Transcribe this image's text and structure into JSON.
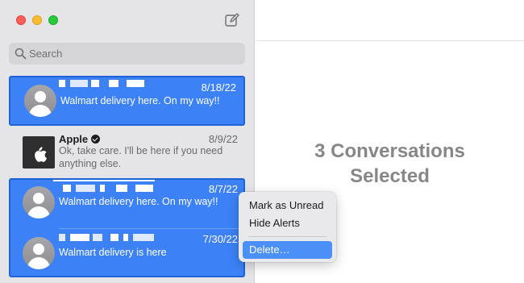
{
  "sidebar": {
    "search_placeholder": "Search",
    "conversations": [
      {
        "name": "",
        "date": "8/18/22",
        "preview": "Walmart delivery here. On my way!!",
        "selected": true
      },
      {
        "name": "Apple",
        "verified": true,
        "date": "8/9/22",
        "preview": "Ok, take care. I'll be here if you need anything else.",
        "selected": false
      },
      {
        "name": "",
        "date": "8/7/22",
        "preview": "Walmart delivery here. On my way!!",
        "selected": true
      },
      {
        "name": "",
        "date": "7/30/22",
        "preview": "Walmart delivery is here",
        "selected": true
      }
    ]
  },
  "main": {
    "status_line1": "3 Conversations",
    "status_line2": "Selected"
  },
  "context_menu": {
    "items": [
      "Mark as Unread",
      "Hide Alerts",
      "Delete…"
    ],
    "highlighted": "Delete…"
  },
  "colors": {
    "selection": "#3c82f6",
    "selection_border": "#1f63d8",
    "sidebar_bg": "#e5e4e6",
    "menu_highlight": "#4a90f7"
  }
}
